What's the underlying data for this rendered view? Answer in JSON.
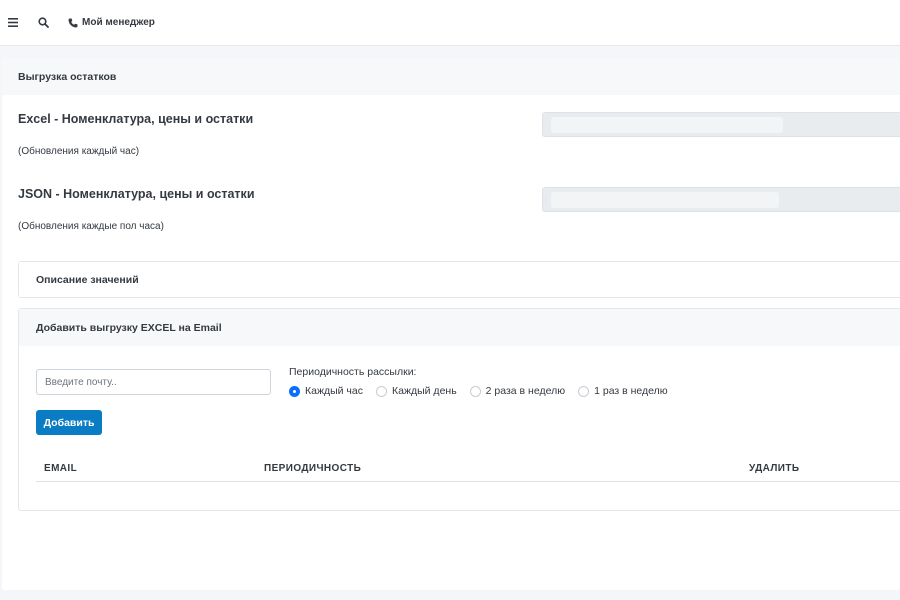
{
  "topbar": {
    "menu_icon": "hamburger-icon",
    "search_icon": "search-icon",
    "manager_icon": "phone-icon",
    "manager_label": "Мой менеджер"
  },
  "card": {
    "title": "Выгрузка остатков",
    "exports": [
      {
        "title": "Excel - Номенклатура, цены и остатки",
        "subtitle": "(Обновления каждый час)"
      },
      {
        "title": "JSON - Номенклатура, цены и остатки",
        "subtitle": "(Обновления каждые пол часа)"
      }
    ],
    "description_header": "Описание значений",
    "email_section": {
      "header": "Добавить выгрузку EXCEL на Email",
      "email_placeholder": "Введите почту..",
      "frequency_label": "Периодичность рассылки:",
      "options": [
        "Каждый час",
        "Каждый день",
        "2 раза в неделю",
        "1 раз в неделю"
      ],
      "selected_option": "Каждый час",
      "add_button": "Добавить",
      "table_columns": [
        "EMAIL",
        "ПЕРИОДИЧНОСТЬ",
        "УДАЛИТЬ"
      ],
      "table_rows": []
    }
  },
  "colors": {
    "accent": "#0d6efd",
    "button": "#0a7cc4",
    "page_bg": "#f4f6f9"
  }
}
